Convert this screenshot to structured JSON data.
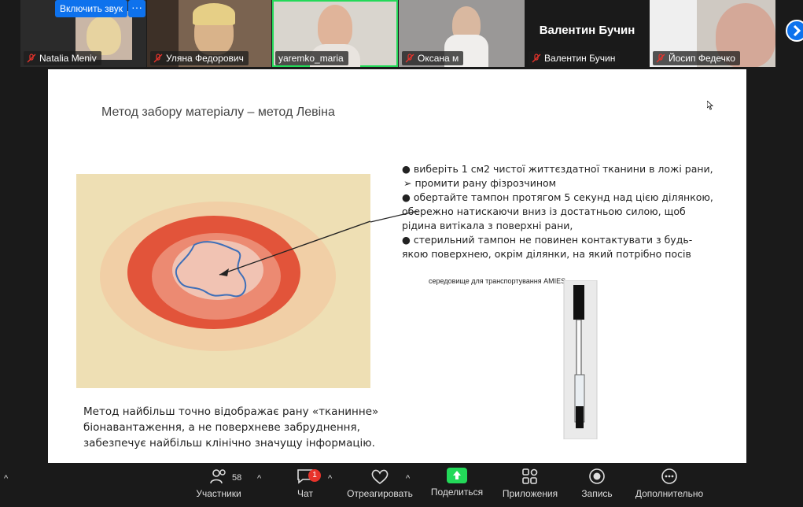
{
  "participants_strip": {
    "unmute_label": "Включить звук",
    "more_label": "···",
    "tiles": [
      {
        "name": "Natalia Meniv"
      },
      {
        "name": "Уляна Федорович"
      },
      {
        "name": "yaremko_maria"
      },
      {
        "name": "Оксана м"
      },
      {
        "name": "Валентин Бучин",
        "big_name": "Валентин Бучин"
      },
      {
        "name": "Йосип Федечко"
      }
    ]
  },
  "slide": {
    "title": "Метод забору матеріалу – метод Левіна",
    "bullets": [
      "● виберіть 1 см2 чистої життєздатної тканини в ложі рани,",
      "➢  промити рану фізрозчином",
      "● обертайте тампон протягом 5 секунд над цією ділянкою, обережно натискаючи вниз із достатньою силою, щоб рідина витікала з поверхні рани,",
      "●  стерильний тампон не повинен контактувати з будь-якою поверхнею, окрім ділянки, на який потрібно посів"
    ],
    "amies_label": "середовище для транспортування AMIES",
    "bottom_text": "Метод найбільш точно відображає рану «тканинне» біонавантаження, а не поверхневе забруднення, забезпечує найбільш клінічно значущу інформацію."
  },
  "toolbar": {
    "participants_label": "Участники",
    "participants_count": "58",
    "chat_label": "Чат",
    "chat_badge": "1",
    "react_label": "Отреагировать",
    "share_label": "Поделиться",
    "apps_label": "Приложения",
    "record_label": "Запись",
    "more_label": "Дополнительно"
  },
  "colors": {
    "accent": "#0e72ed",
    "share_green": "#23d959",
    "badge_red": "#e8332b"
  }
}
